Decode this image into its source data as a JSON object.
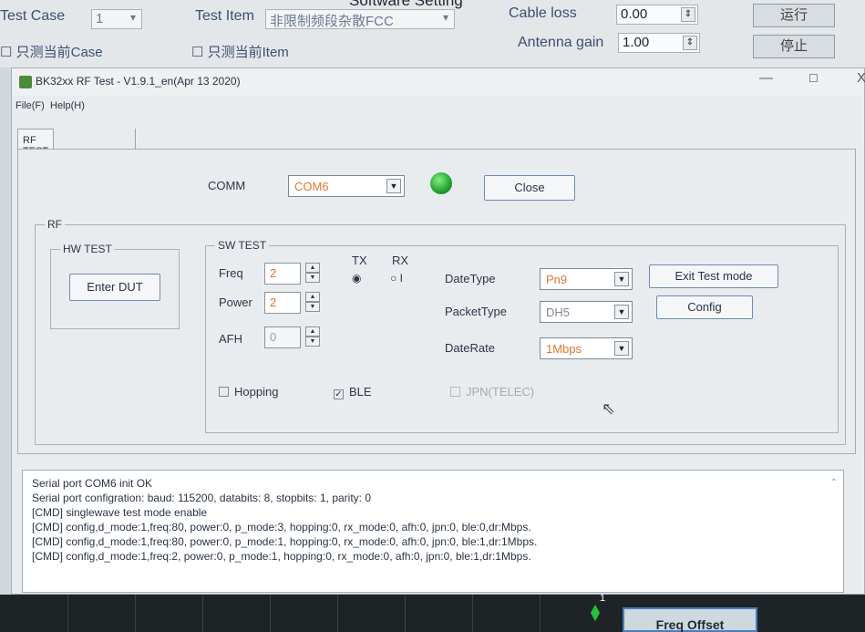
{
  "background_window": {
    "title": "Software Setting",
    "test_case_label": "Test Case",
    "test_case_value": "1",
    "test_item_label": "Test Item",
    "test_item_value": "非限制频段杂散FCC",
    "cable_loss_label": "Cable loss",
    "cable_loss_value": "0.00",
    "antenna_gain_label": "Antenna gain",
    "antenna_gain_value": "1.00",
    "run_button": "运行",
    "stop_button": "停止",
    "only_case_checkbox": "只测当前Case",
    "only_item_checkbox": "只测当前Item"
  },
  "window": {
    "title": "BK32xx RF Test - V1.9.1_en(Apr 13 2020)",
    "minimize": "—",
    "maximize": "☐",
    "close": "X",
    "menu": [
      "File(F)",
      "Help(H)"
    ],
    "tabs": [
      "RF TEST"
    ]
  },
  "comm": {
    "label": "COMM",
    "port": "COM6",
    "close_button": "Close",
    "led_color": "#22a830"
  },
  "rf": {
    "group_label": "RF",
    "hw_test": {
      "label": "HW TEST",
      "enter_dut_button": "Enter DUT"
    },
    "sw_test": {
      "label": "SW TEST",
      "freq_label": "Freq",
      "freq_value": "2",
      "power_label": "Power",
      "power_value": "2",
      "afh_label": "AFH",
      "afh_value": "0",
      "tx_label": "TX",
      "rx_label": "RX",
      "tx_selected": true,
      "datetype_label": "DateType",
      "datetype_value": "Pn9",
      "packettype_label": "PacketType",
      "packettype_value": "DH5",
      "daterate_label": "DateRate",
      "daterate_value": "1Mbps",
      "exit_test_mode_button": "Exit Test mode",
      "config_button": "Config",
      "hopping_label": "Hopping",
      "hopping_checked": false,
      "ble_label": "BLE",
      "ble_checked": true,
      "jpn_label": "JPN(TELEC)",
      "jpn_checked": false
    }
  },
  "log": {
    "lines": [
      "Serial port COM6 init OK",
      "Serial port configration: baud: 115200, databits: 8, stopbits: 1, parity: 0",
      "[CMD] singlewave test mode enable",
      "[CMD] config,d_mode:1,freq:80, power:0, p_mode:3, hopping:0, rx_mode:0, afh:0, jpn:0, ble:0,dr:Mbps.",
      "[CMD] config,d_mode:1,freq:80, power:0, p_mode:1, hopping:0, rx_mode:0, afh:0, jpn:0, ble:1,dr:1Mbps.",
      "[CMD] config,d_mode:1,freq:2, power:0, p_mode:1, hopping:0, rx_mode:0, afh:0, jpn:0, ble:1,dr:1Mbps."
    ]
  },
  "bottom": {
    "marker_number": "1",
    "freq_offset_button": "Freq Offset"
  }
}
